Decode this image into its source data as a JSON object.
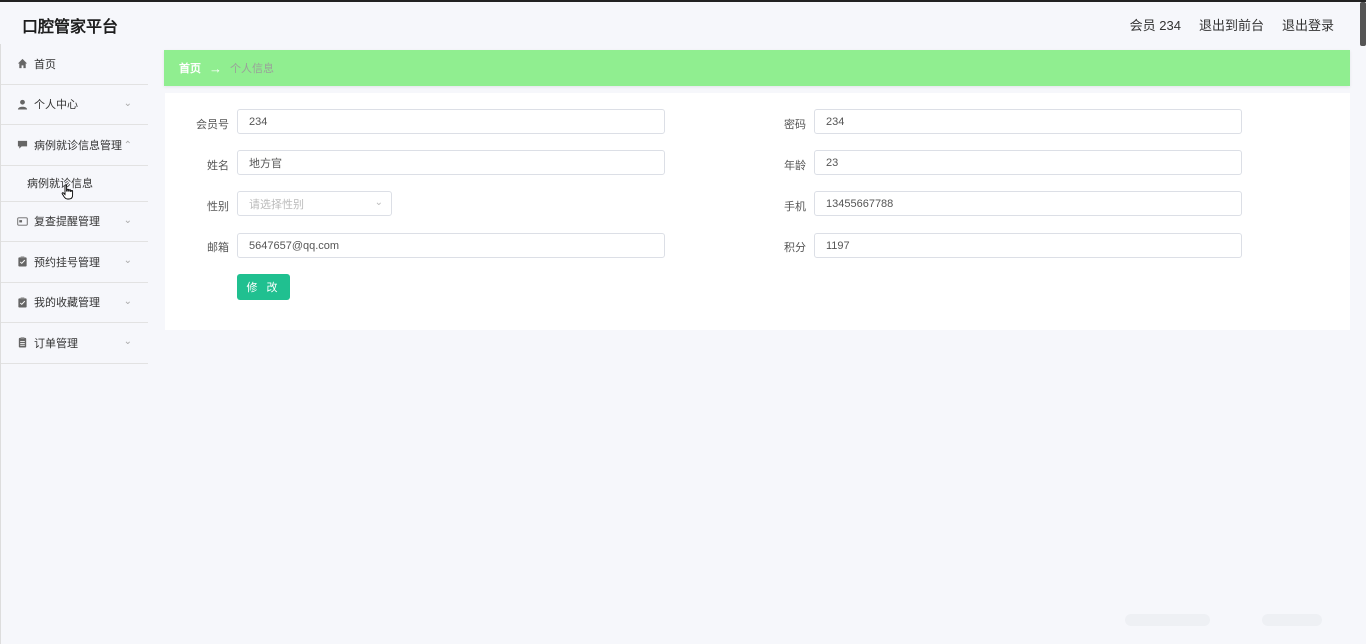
{
  "app": {
    "title": "口腔管家平台"
  },
  "header": {
    "user": "会员 234",
    "front_link": "退出到前台",
    "logout_link": "退出登录"
  },
  "sidebar": {
    "items": [
      {
        "label": "首页",
        "icon": "home-icon"
      },
      {
        "label": "个人中心",
        "icon": "user-icon"
      },
      {
        "label": "病例就诊信息管理",
        "icon": "chat-icon",
        "expanded": true,
        "children": [
          {
            "label": "病例就诊信息"
          }
        ]
      },
      {
        "label": "复查提醒管理",
        "icon": "card-icon"
      },
      {
        "label": "预约挂号管理",
        "icon": "clipboard-icon"
      },
      {
        "label": "我的收藏管理",
        "icon": "clipboard-icon"
      },
      {
        "label": "订单管理",
        "icon": "document-icon"
      }
    ]
  },
  "breadcrumb": {
    "home": "首页",
    "separator": "→",
    "current": "个人信息"
  },
  "form": {
    "member_no": {
      "label": "会员号",
      "value": "234"
    },
    "password": {
      "label": "密码",
      "value": "234"
    },
    "name": {
      "label": "姓名",
      "value": "地方官"
    },
    "age": {
      "label": "年龄",
      "value": "23"
    },
    "gender": {
      "label": "性别",
      "placeholder": "请选择性别"
    },
    "phone": {
      "label": "手机",
      "value": "13455667788"
    },
    "email": {
      "label": "邮箱",
      "value": "5647657@qq.com"
    },
    "points": {
      "label": "积分",
      "value": "1197"
    },
    "submit_label": "修 改"
  },
  "colors": {
    "breadcrumb_bg": "#90ee90",
    "button_bg": "#20c090",
    "page_bg": "#f6f7fb"
  }
}
